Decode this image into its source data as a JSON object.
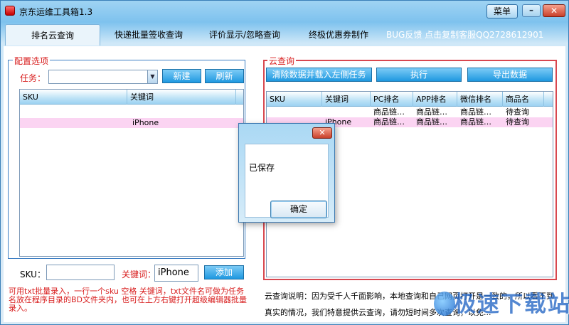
{
  "window": {
    "title": "京东运维工具箱1.3",
    "menu_label": "菜单",
    "minimize_glyph": "–",
    "close_glyph": "✕"
  },
  "tabs": [
    {
      "label": "排名云查询",
      "active": true
    },
    {
      "label": "快递批量签收查询"
    },
    {
      "label": "评价显示/忽略查询"
    },
    {
      "label": "终极优惠券制作"
    }
  ],
  "bug_text": "BUG反馈  点击复制客服QQ2728612901",
  "config": {
    "title": "配置选项",
    "task_label": "任务：",
    "task_value": "",
    "new_label": "新建",
    "refresh_label": "刷新",
    "columns": [
      "SKU",
      "关键词"
    ],
    "rows": [
      {
        "sku": "",
        "keyword": "iPhone",
        "highlight": true
      }
    ],
    "sku_label": "SKU：",
    "sku_value": "",
    "keyword_label": "关键词：",
    "keyword_value": "iPhone",
    "add_label": "添加"
  },
  "note": "可用txt批量录入，一行一个sku 空格 关键词，txt文件名可做为任务名放在程序目录的BD文件夹内，也可在上方右键打开超级编辑器批量录入。",
  "cloud": {
    "title": "云查询",
    "clear_load_label": "清除数据并载入左侧任务",
    "run_label": "执行",
    "export_label": "导出数据",
    "columns": [
      "SKU",
      "关键词",
      "PC排名",
      "APP排名",
      "微信排名",
      "商品名"
    ],
    "rows": [
      {
        "sku": "",
        "keyword": "",
        "pc": "商品链…",
        "app": "商品链…",
        "wx": "商品链…",
        "name": "待查询",
        "highlight": false
      },
      {
        "sku": "",
        "keyword": "iPhone",
        "pc": "商品链…",
        "app": "商品链…",
        "wx": "商品链…",
        "name": "待查询",
        "highlight": true
      }
    ]
  },
  "description": "云查询说明：因为受千人千面影响，本地查询和自己网页打开是一致的，所以看不到真实的情况，我们特意提供云查询，请勿短时间多次查询，以免...",
  "dialog": {
    "message": "已保存",
    "ok_label": "确定",
    "close_glyph": "✕"
  },
  "watermark": {
    "text": "极速下载站"
  },
  "colors": {
    "accent_blue": "#1e98e0",
    "label_red": "#d81d1d",
    "highlight_pink": "#fbd4f2"
  }
}
